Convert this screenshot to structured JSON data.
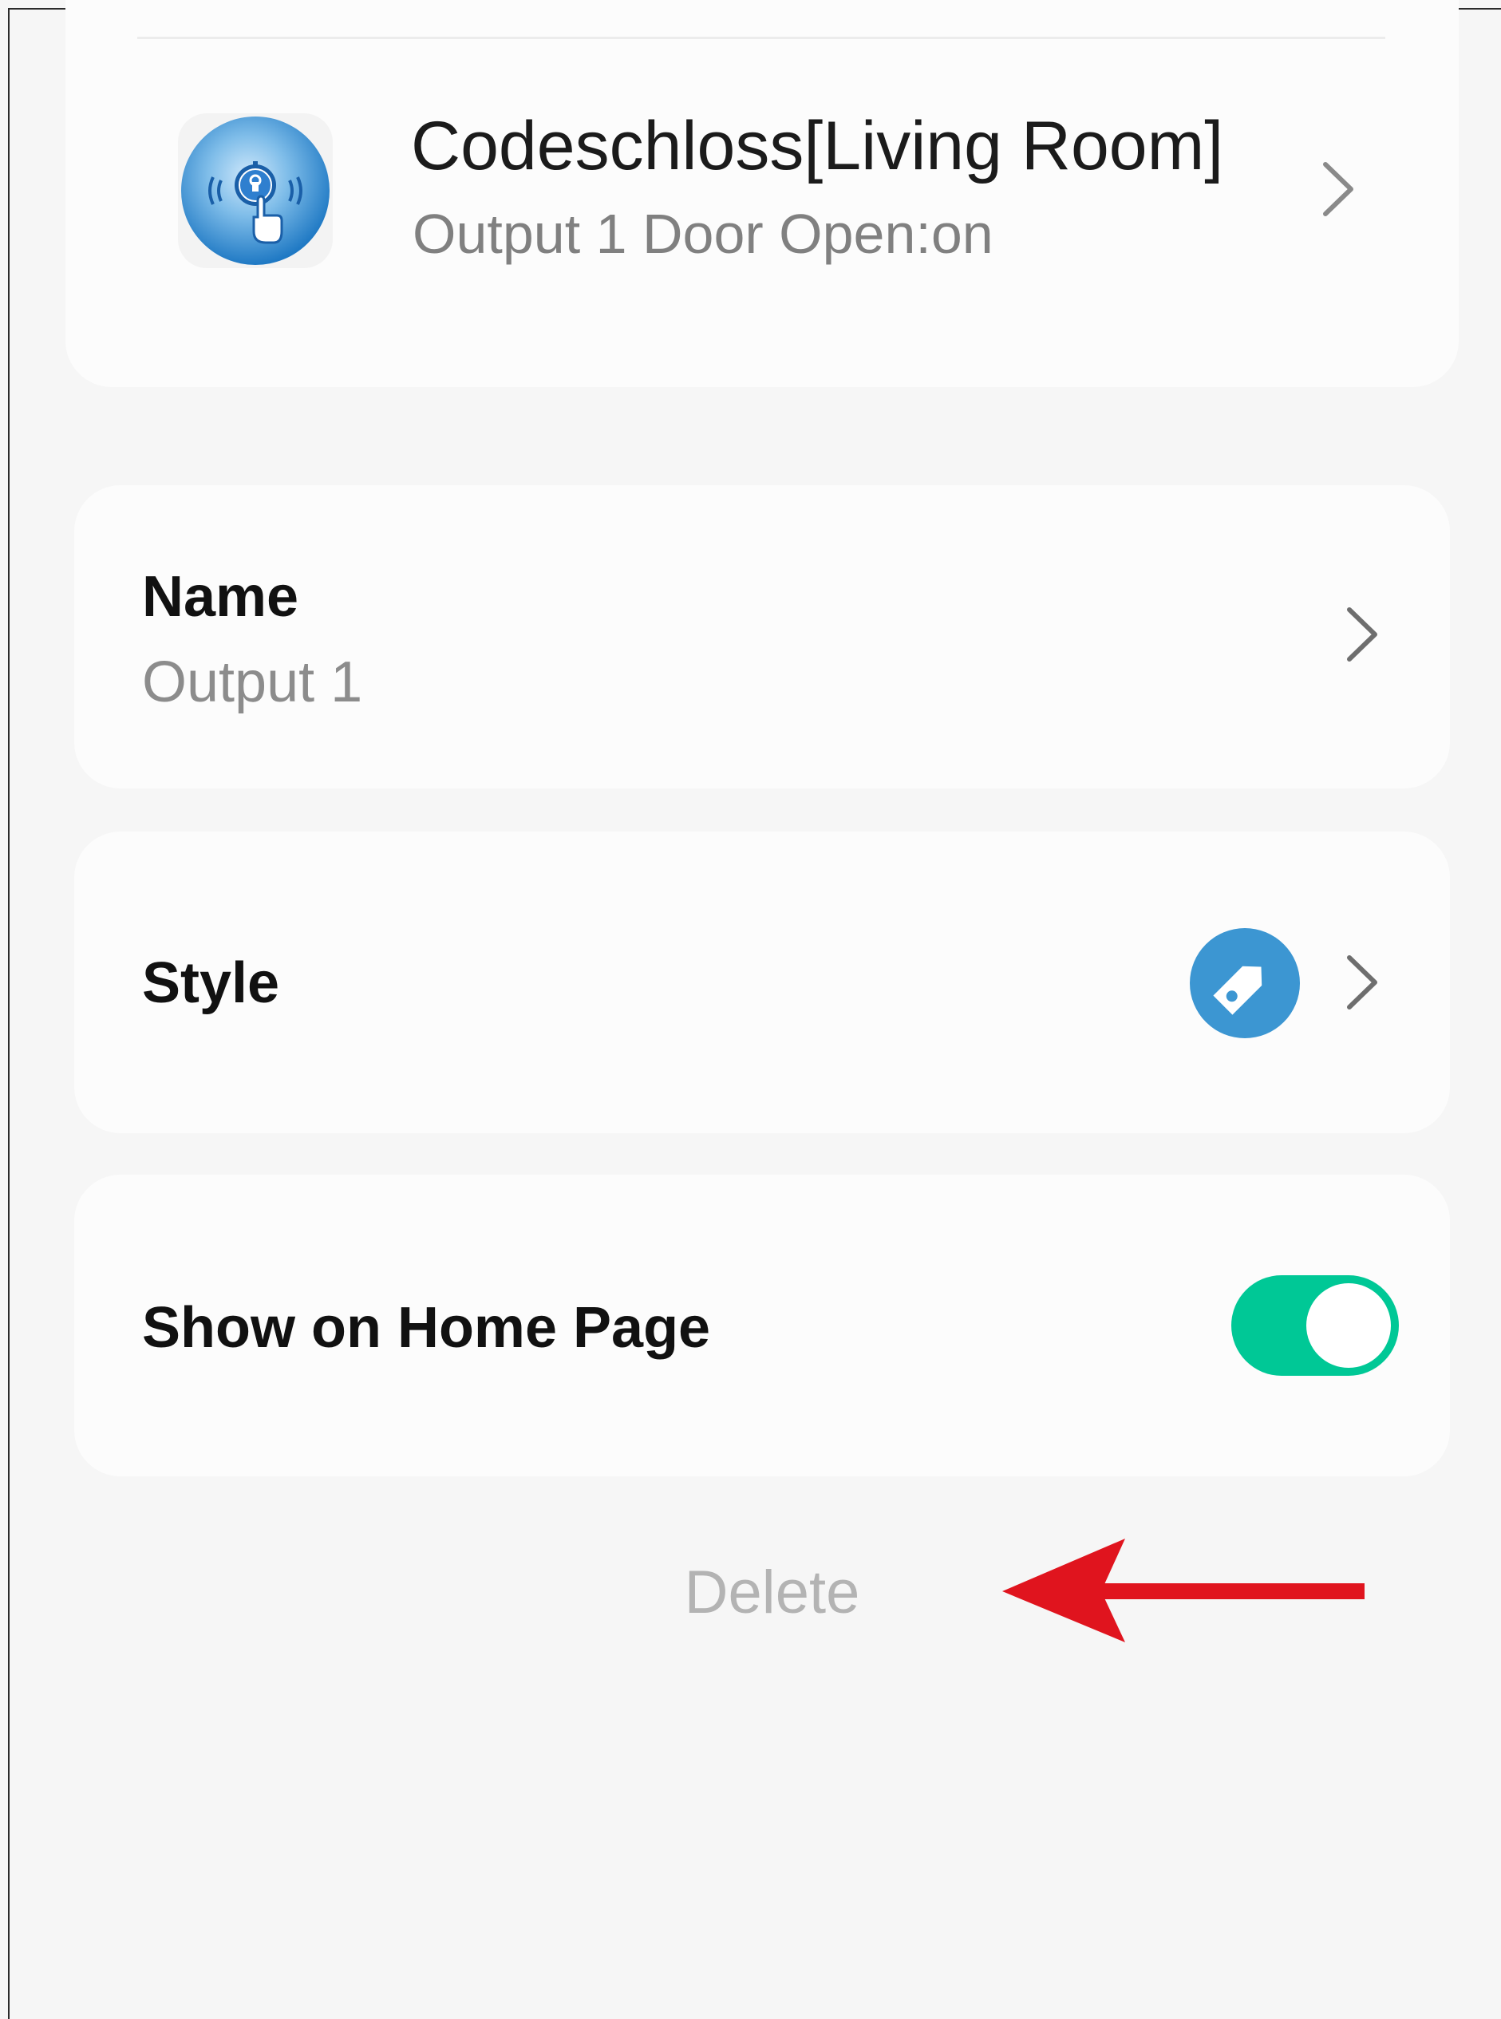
{
  "device": {
    "title": "Codeschloss[Living Room]",
    "subtitle": "Output 1 Door Open:on",
    "icon": "keypad-lock-icon",
    "chevron": "chevron-right-icon"
  },
  "settings": {
    "name": {
      "label": "Name",
      "value": "Output 1",
      "chevron": "chevron-right-icon"
    },
    "style": {
      "label": "Style",
      "icon": "tag-icon",
      "icon_color": "#3c96d2",
      "chevron": "chevron-right-icon"
    },
    "show_on_home": {
      "label": "Show on Home Page",
      "toggle_state": "on",
      "toggle_color": "#00c896"
    }
  },
  "actions": {
    "delete_label": "Delete"
  },
  "annotation": {
    "arrow": "left-arrow-annotation",
    "arrow_color": "#e0141e"
  }
}
